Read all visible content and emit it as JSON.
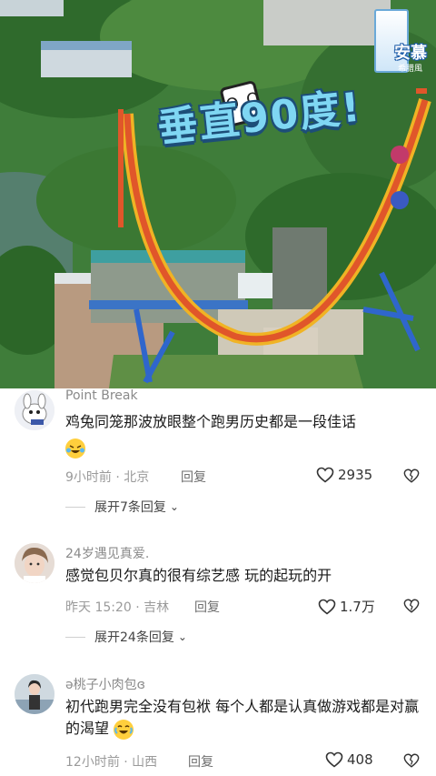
{
  "video": {
    "caption": "垂直90度!",
    "brand_text": "安慕",
    "brand_sub": "希腊風"
  },
  "comments": [
    {
      "username": "Point Break",
      "text": "鸡兔同笼那波放眼整个跑男历史都是一段佳话",
      "emoji": "crying-laughing-emoji",
      "time_location": "9小时前 · 北京",
      "reply_label": "回复",
      "likes": "2935",
      "expand_label": "展开7条回复"
    },
    {
      "username": "24岁遇见真爱.",
      "text": "感觉包贝尔真的很有综艺感 玩的起玩的开",
      "time_location": "昨天 15:20 · 吉林",
      "reply_label": "回复",
      "likes": "1.7万",
      "expand_label": "展开24条回复"
    },
    {
      "username": "ə桃子小肉包ɞ",
      "text": "初代跑男完全没有包袱 每个人都是认真做游戏都是对赢的渴望",
      "emoji": "tears-of-joy-emoji",
      "time_location": "12小时前 · 山西",
      "reply_label": "回复",
      "likes": "408"
    }
  ],
  "colors": {
    "text_primary": "#1a1a1a",
    "text_secondary": "#9a9a9a",
    "emoji_yellow": "#ffcf3d"
  }
}
